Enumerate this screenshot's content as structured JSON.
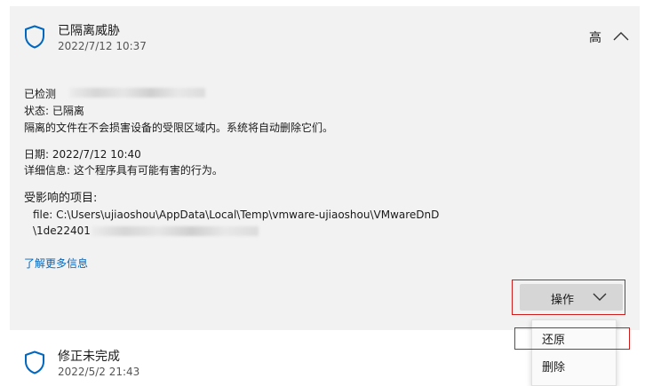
{
  "card1": {
    "title": "已隔离威胁",
    "date": "2022/7/12 10:37",
    "severity": "高",
    "detected_label": "已检测",
    "status": "状态: 已隔离",
    "description": "隔离的文件在不会损害设备的受限区域内。系统将自动删除它们。",
    "date_line": "日期: 2022/7/12 10:40",
    "details": "详细信息: 这个程序具有可能有害的行为。",
    "affected_heading": "受影响的项目:",
    "file_line1": "file: C:\\Users\\ujiaoshou\\AppData\\Local\\Temp\\vmware-ujiaoshou\\VMwareDnD",
    "file_line2": "\\1de22401",
    "learn_more": "了解更多信息",
    "action_button": "操作"
  },
  "action_menu": {
    "items": [
      "还原",
      "删除"
    ]
  },
  "card2": {
    "title": "修正未完成",
    "date": "2022/5/2 21:43"
  },
  "icons": {
    "shield": "shield-icon",
    "chevron_up": "chevron-up-icon",
    "chevron_down": "chevron-down-icon"
  },
  "colors": {
    "card_bg": "#f2f2f2",
    "link": "#0067c0",
    "shield": "#0067c0",
    "annotation_red": "#d21b1b"
  }
}
